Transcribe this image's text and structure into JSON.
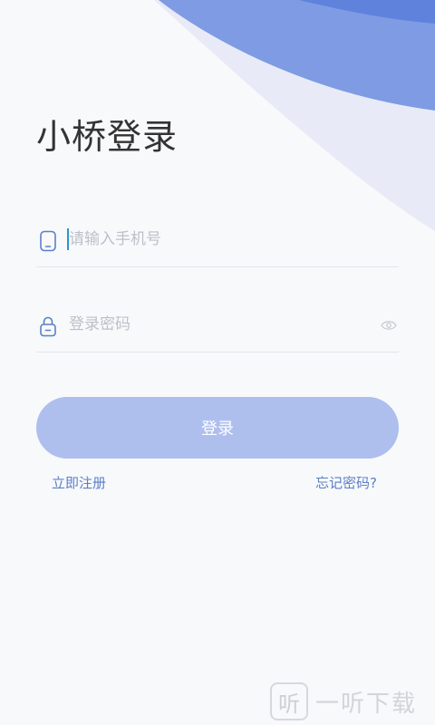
{
  "page": {
    "title": "小桥登录"
  },
  "phone": {
    "placeholder": "请输入手机号",
    "value": "",
    "icon": "phone-icon"
  },
  "password": {
    "placeholder": "登录密码",
    "value": "",
    "icon": "lock-icon",
    "toggle_icon": "eye-icon"
  },
  "login_button": {
    "label": "登录"
  },
  "links": {
    "register": "立即注册",
    "forgot": "忘记密码?"
  },
  "watermark": {
    "glyph": "听",
    "text": "一听下载"
  },
  "colors": {
    "accent": "#aebfee",
    "link": "#5a7fc7",
    "wave_dark": "#5f82dd",
    "wave_mid": "#7e9be4",
    "wave_light": "#e8ebf7"
  }
}
